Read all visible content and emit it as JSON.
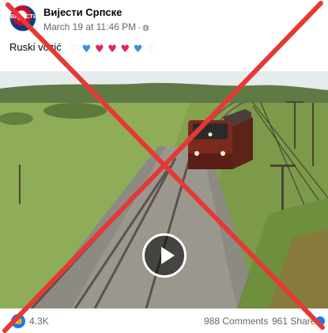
{
  "post": {
    "page_name": "Вијести Српске",
    "timestamp": "March 19 at 11:46 PM",
    "audience_icon": "globe-icon",
    "caption": "Ruski voz",
    "caption_suffix": "ić",
    "emojis": [
      "white-heart",
      "blue-heart",
      "red-heart",
      "red-heart",
      "red-heart",
      "blue-heart",
      "white-heart"
    ]
  },
  "video": {
    "play_icon": "play-icon"
  },
  "footer": {
    "reactions": "4.3K",
    "comments": "988 Comments",
    "shares": "961 Shares"
  },
  "overlay": {
    "color": "#e53935",
    "meaning": "cross-out-x"
  }
}
